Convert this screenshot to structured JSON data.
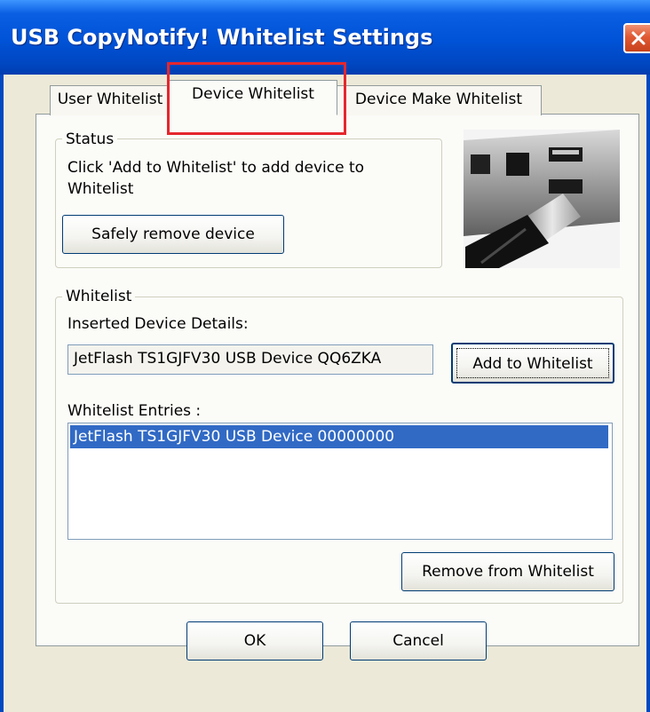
{
  "window": {
    "title": "USB CopyNotify! Whitelist Settings",
    "close_icon": "close-icon"
  },
  "tabs": [
    {
      "label": "User Whitelist",
      "active": false
    },
    {
      "label": "Device Whitelist",
      "active": true
    },
    {
      "label": "Device Make Whitelist",
      "active": false
    }
  ],
  "status": {
    "legend": "Status",
    "message_line1": "Click 'Add to Whitelist' to add device to",
    "message_line2": "Whitelist",
    "safely_remove_label": "Safely remove device"
  },
  "image": {
    "icon": "usb-plug-photo"
  },
  "whitelist": {
    "legend": "Whitelist",
    "inserted_label": "Inserted Device Details:",
    "inserted_value": "JetFlash TS1GJFV30 USB Device QQ6ZKA",
    "add_label": "Add to Whitelist",
    "entries_label": "Whitelist Entries :",
    "entries": [
      "JetFlash TS1GJFV30 USB Device 00000000"
    ],
    "remove_label": "Remove from Whitelist"
  },
  "footer": {
    "ok_label": "OK",
    "cancel_label": "Cancel"
  },
  "colors": {
    "title_bar": "#0052D6",
    "dialog_bg": "#ECE9D8",
    "selection": "#316AC5",
    "highlight": "#E5272D"
  }
}
